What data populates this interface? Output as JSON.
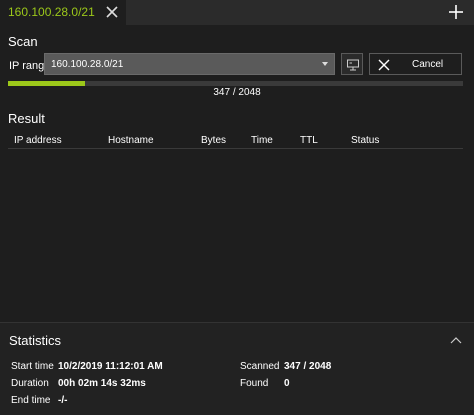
{
  "tab": {
    "title": "160.100.28.0/21"
  },
  "scan": {
    "section_title": "Scan",
    "ip_range_label": "IP range",
    "ip_range_value": "160.100.28.0/21",
    "cancel_label": "Cancel",
    "progress_text": "347 / 2048",
    "progress_fraction": 0.169
  },
  "result": {
    "section_title": "Result",
    "columns": [
      "IP address",
      "Hostname",
      "Bytes",
      "Time",
      "TTL",
      "Status"
    ],
    "rows": []
  },
  "statistics": {
    "section_title": "Statistics",
    "start_time_label": "Start time",
    "start_time_value": "10/2/2019 11:12:01 AM",
    "duration_label": "Duration",
    "duration_value": "00h 02m 14s 32ms",
    "end_time_label": "End time",
    "end_time_value": "-/-",
    "scanned_label": "Scanned",
    "scanned_value": "347 / 2048",
    "found_label": "Found",
    "found_value": "0"
  },
  "colors": {
    "accent": "#9cc81a",
    "background": "#1e1e1e"
  },
  "icons": {
    "tab_close": "close-icon",
    "add_tab": "plus-icon",
    "monitor": "monitor-icon",
    "cancel": "close-icon",
    "collapse": "chevron-up-icon"
  }
}
